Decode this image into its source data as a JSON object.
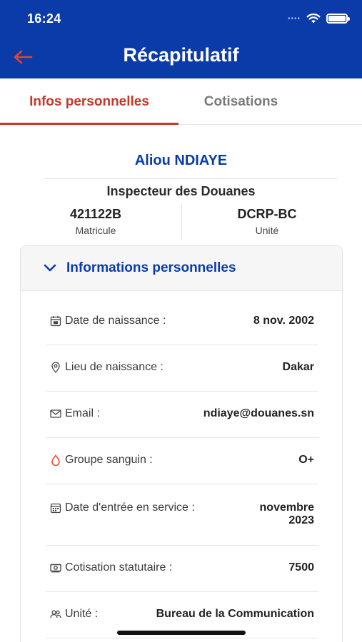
{
  "status_bar": {
    "time": "16:24"
  },
  "header": {
    "title": "Récapitulatif"
  },
  "tabs": [
    {
      "label": "Infos personnelles",
      "active": true
    },
    {
      "label": "Cotisations",
      "active": false
    }
  ],
  "profile": {
    "name": "Aliou NDIAYE",
    "grade": "Inspecteur des Douanes",
    "matricule_value": "421122B",
    "matricule_label": "Matricule",
    "unite_value": "DCRP-BC",
    "unite_label": "Unité"
  },
  "section": {
    "title": "Informations personnelles",
    "rows": [
      {
        "label": "Date de naissance :",
        "value": "8 nov. 2002",
        "icon": "calendar-icon"
      },
      {
        "label": "Lieu de naissance :",
        "value": "Dakar",
        "icon": "location-pin-icon"
      },
      {
        "label": "Email :",
        "value": "ndiaye@douanes.sn",
        "icon": "envelope-icon"
      },
      {
        "label": "Groupe sanguin :",
        "value": "O+",
        "icon": "blood-drop-icon"
      },
      {
        "label": "Date d'entrée en service :",
        "value_line1": "novembre",
        "value_line2": "2023",
        "icon": "calendar-grid-icon"
      },
      {
        "label": "Cotisation statutaire :",
        "value": "7500",
        "icon": "money-icon"
      },
      {
        "label": "Unité :",
        "value": "Bureau de la Communication",
        "icon": "people-icon"
      }
    ]
  },
  "colors": {
    "primary": "#0b3ba8",
    "accent": "#c0392b",
    "blood": "#e74c3c"
  }
}
